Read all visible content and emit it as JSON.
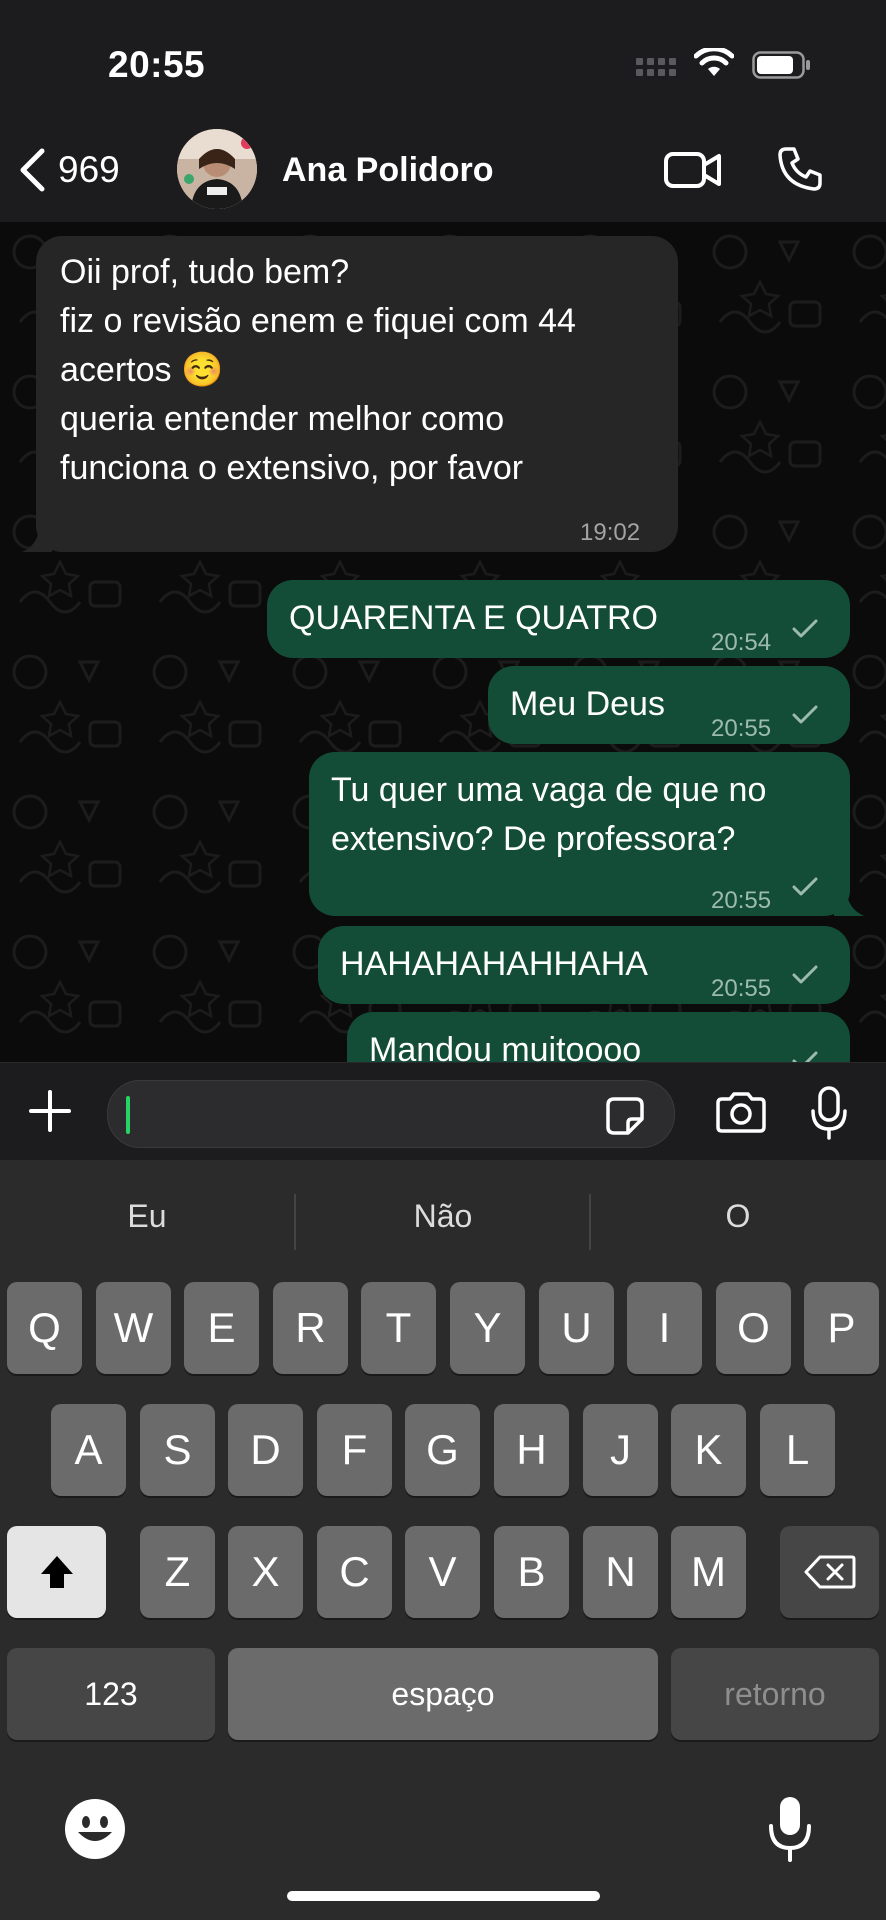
{
  "status_bar": {
    "time": "20:55"
  },
  "header": {
    "back_count": "969",
    "contact_name": "Ana Polidoro"
  },
  "messages": [
    {
      "direction": "incoming",
      "lines": [
        "Oii prof, tudo bem?",
        "fiz o revisão enem e fiquei com 44",
        "acertos ☺️",
        "queria entender melhor como",
        "funciona o extensivo, por favor"
      ],
      "time": "19:02"
    },
    {
      "direction": "outgoing",
      "lines": [
        "QUARENTA E QUATRO"
      ],
      "time": "20:54"
    },
    {
      "direction": "outgoing",
      "lines": [
        "Meu Deus"
      ],
      "time": "20:55"
    },
    {
      "direction": "outgoing",
      "lines": [
        "Tu quer uma vaga de que no",
        "extensivo? De professora?"
      ],
      "time": "20:55"
    },
    {
      "direction": "outgoing",
      "lines": [
        "HAHAHAHAHHAHA"
      ],
      "time": "20:55"
    },
    {
      "direction": "outgoing",
      "lines": [
        "Mandou muitoooo"
      ],
      "time": "20:55"
    }
  ],
  "input": {
    "placeholder": ""
  },
  "keyboard": {
    "suggestions": [
      "Eu",
      "Não",
      "O"
    ],
    "row1": [
      "Q",
      "W",
      "E",
      "R",
      "T",
      "Y",
      "U",
      "I",
      "O",
      "P"
    ],
    "row2": [
      "A",
      "S",
      "D",
      "F",
      "G",
      "H",
      "J",
      "K",
      "L"
    ],
    "row3": [
      "Z",
      "X",
      "C",
      "V",
      "B",
      "N",
      "M"
    ],
    "numbers_label": "123",
    "space_label": "espaço",
    "return_label": "retorno"
  },
  "colors": {
    "outgoing_bubble": "#134d37",
    "incoming_bubble": "#262626",
    "accent": "#25d366"
  },
  "icons": [
    "chevron-left-icon",
    "video-camera-icon",
    "phone-icon",
    "plus-icon",
    "sticker-icon",
    "camera-icon",
    "microphone-icon",
    "shift-icon",
    "backspace-icon",
    "emoji-icon",
    "dictation-icon",
    "read-check-icon"
  ]
}
